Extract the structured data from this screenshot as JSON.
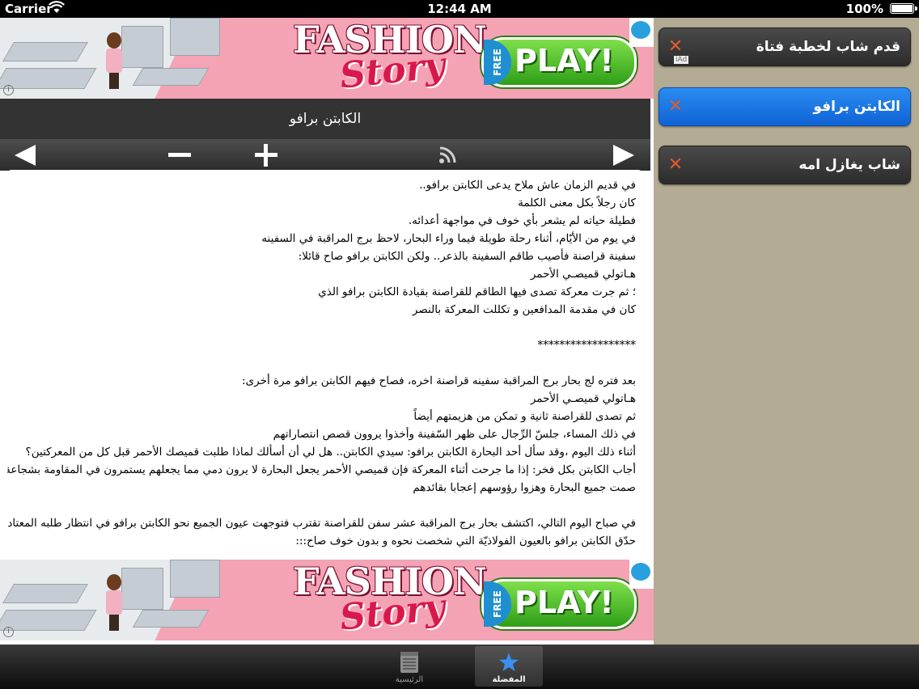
{
  "status_bar": {
    "carrier": "Carrier",
    "time": "12:44 AM",
    "battery": "100%"
  },
  "ad": {
    "brand_line1": "FASHION",
    "brand_line2": "Story",
    "free": "FREE",
    "play": "PLAY!",
    "ad_tag": "iAd"
  },
  "article": {
    "title": "الكابتن برافو",
    "lines": [
      "في قديم الزمان عاش ملاح يدعى الكابتن برافو..",
      "كان رجلاً بكل معنى الكلمة",
      "فطيلة حياته لم يشعر بأي خوف في مواجهة أعدائه.",
      "في يوم من الأيّام، أثناء رحلة طويلة فيما وراء البحار، لاحظ برج المراقبة في السفينه",
      "سفينة قراصنة فأصيب طاقم السفينة بالذعر.. ولكن الكابتن برافو صاح قائلا:",
      "هـاتولي قميصـي الأحمر",
      "؛ ثم جرت معركة تصدى فيها الطاقم للقراصنة بقيادة الكابتن برافو الذي",
      "كان في مقدمة المدافعين و تكللت المعركة بالنصر",
      "",
      "******************",
      "",
      "بعد فتره لج بحار برج المراقبة سفينه قراصنة اخره، فصاح فيهم الكابتن برافو مرة أخرى:",
      "هـاتولي قميصـي الأحمر",
      "ثم تصدى للقراصنة ثانية و تمكن من هزيمتهم أيضاً",
      "في ذلك المساء، جلسّ الرِّجال على ظهر السّفينة وأخذوا يروون قصص انتصاراتهم",
      "أثناء ذلك اليوم ،وقد سأل أحد البحارة الكابتن برافو: سيدي الكابتن.. هل لي أن أسألك لماذا طلبت قميصك الأحمر قبل كل من المعركتين؟",
      "أجاب الكابتن بكل فخر: إذا ما جرحت أثناء المعركة فإن قميصي الأحمر يجعل البحارة لا يرون دمي مما يجعلهم يستمرون في المقاومة بشجاعة",
      "صمت جميع البحارة وهزوا رؤوسهم إعجابا بقائدهم",
      "",
      "في صباح اليوم التالي، اكتشف بحار برج المراقبة عشر سفن للقراصنة تقترب فتوجهت عيون الجميع نحو الكابتن برافو في انتظار طلبه المعتاد",
      "حدّق الكابتن برافو بالعيون الفولاذيّة التي شخصت نحوه و بدون خوف صاح:::"
    ]
  },
  "favorites": [
    {
      "label": "قدم شاب لخطبة فتاة",
      "selected": false
    },
    {
      "label": "الكابتن برافو",
      "selected": true
    },
    {
      "label": "شاب يغازل امه",
      "selected": false
    }
  ],
  "tabs": [
    {
      "label": "الرئيسية",
      "icon": "notepad-icon",
      "selected": false
    },
    {
      "label": "المفضلة",
      "icon": "star-icon",
      "selected": true
    }
  ]
}
